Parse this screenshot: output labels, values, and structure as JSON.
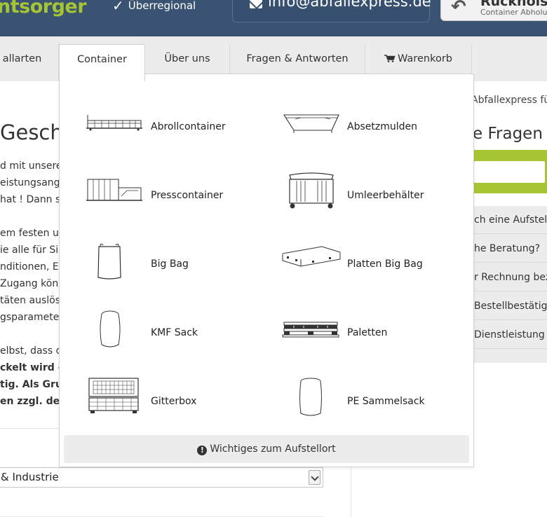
{
  "header": {
    "brand": "ntsorger",
    "badge": "Überregional",
    "email": "info@abfallexpress.de",
    "rueck_title": "Rückholser",
    "rueck_sub": "Container Abholu"
  },
  "nav": {
    "items": [
      "allarten",
      "Container",
      "Über uns",
      "Fragen & Antworten",
      "Warenkorb"
    ],
    "active_index": 1
  },
  "dropdown": {
    "items": [
      {
        "label": "Abrollcontainer",
        "icon": "abrollcontainer-icon"
      },
      {
        "label": "Absetzmulden",
        "icon": "absetzmulde-icon"
      },
      {
        "label": "Presscontainer",
        "icon": "presscontainer-icon"
      },
      {
        "label": "Umleerbehälter",
        "icon": "umleerbehaelter-icon"
      },
      {
        "label": "Big Bag",
        "icon": "big-bag-icon"
      },
      {
        "label": "Platten Big Bag",
        "icon": "platten-big-bag-icon"
      },
      {
        "label": "KMF Sack",
        "icon": "kmf-sack-icon"
      },
      {
        "label": "Paletten",
        "icon": "paletten-icon"
      },
      {
        "label": "Gitterbox",
        "icon": "gitterbox-icon"
      },
      {
        "label": "PE Sammelsack",
        "icon": "pe-sammelsack-icon"
      }
    ],
    "button": "Wichtiges zum Aufstellort"
  },
  "page": {
    "heading": "Geschä",
    "lines": [
      "d mit unseren",
      "eistungsange",
      "hat ! Dann sc",
      "em festen un",
      "ie alle für Sie",
      "nditionen, En",
      "Zugang könne",
      "täten auslöse",
      "gsparameter",
      "elbst, dass di",
      "ckelt wird – V",
      "tig. Als Grun",
      "en zzgl. der g"
    ],
    "select_value": "& Industrie"
  },
  "sidebar": {
    "title": "Abfallexpress für",
    "faq_heading": "e Fragen",
    "faq_items": [
      "ch eine Aufstellg",
      "he Beratung?",
      "r Rechnung beza",
      "Bestellbestätigun",
      "Dienstleistung b"
    ]
  },
  "colors": {
    "header_bg": "#3a5373",
    "brand_green": "#a6c532",
    "nav_bg": "#ececec"
  }
}
